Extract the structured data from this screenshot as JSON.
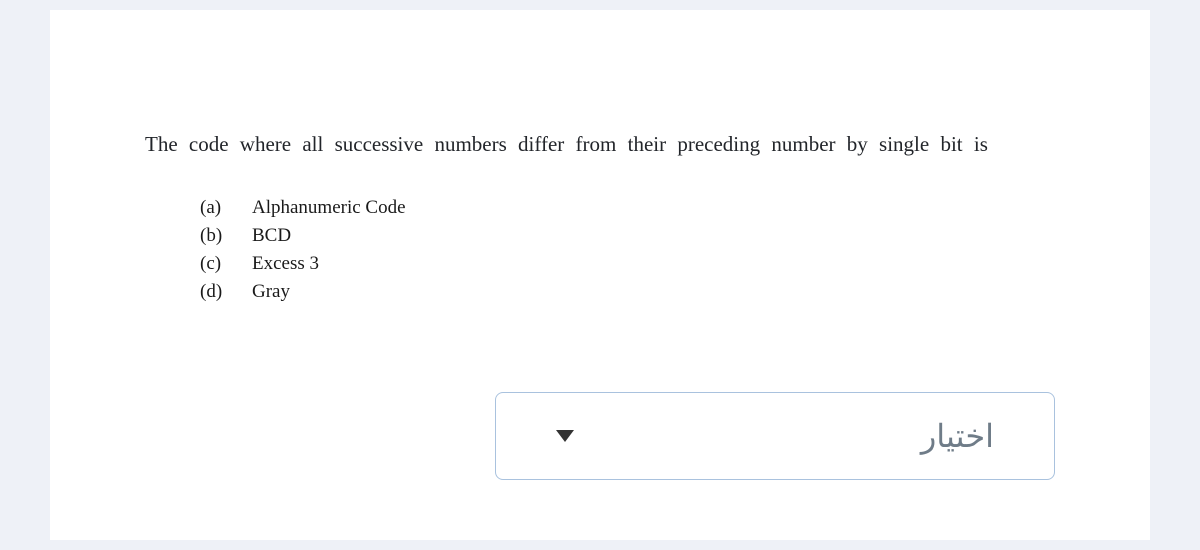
{
  "question": {
    "text": "The code where all successive numbers differ from their preceding number by single bit is",
    "options": [
      {
        "label": "(a)",
        "text": "Alphanumeric Code"
      },
      {
        "label": "(b)",
        "text": "BCD"
      },
      {
        "label": "(c)",
        "text": "Excess 3"
      },
      {
        "label": "(d)",
        "text": "Gray"
      }
    ]
  },
  "select": {
    "placeholder": "اختيار"
  }
}
